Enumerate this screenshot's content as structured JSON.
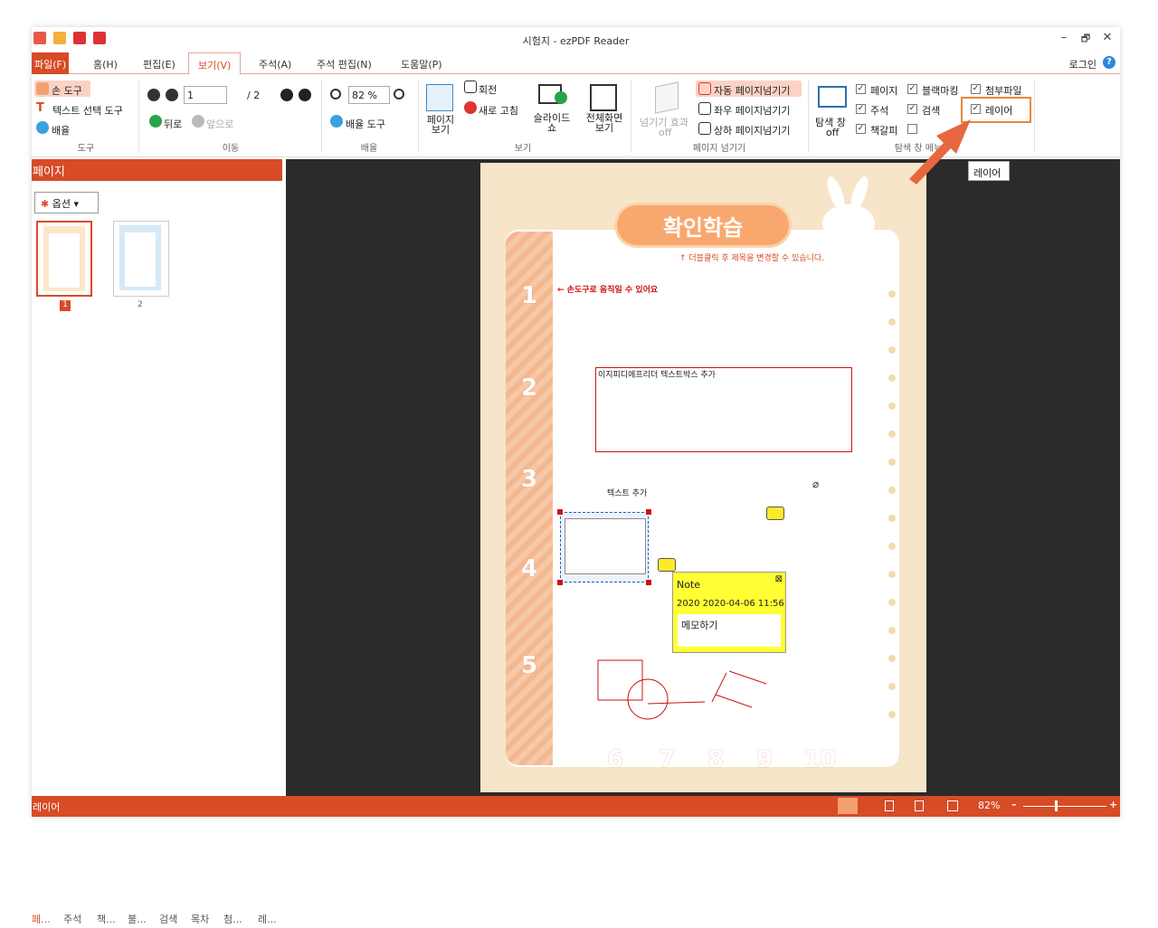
{
  "window": {
    "title": "시험지 - ezPDF Reader",
    "minimize": "–",
    "restore": "🗗",
    "close": "✕"
  },
  "menu": {
    "file": "파일(F)",
    "home": "홈(H)",
    "edit": "편집(E)",
    "view": "보기(V)",
    "annot": "주석(A)",
    "annot_edit": "주석 편집(N)",
    "help": "도움말(P)",
    "login": "로그인",
    "help_icon": "?"
  },
  "ribbon": {
    "tools": {
      "hand": "손 도구",
      "text_select": "텍스트 선택 도구",
      "zoom": "배율",
      "label": "도구"
    },
    "move": {
      "page_value": "1",
      "total": "/ 2",
      "back": "뒤로",
      "forward": "앞으로",
      "label": "이동"
    },
    "zoom": {
      "value": "82 %",
      "zoom_tool": "배율 도구",
      "label": "배율"
    },
    "view": {
      "page_view": "페이지 보기",
      "rotate": "회전",
      "refresh": "새로 고침",
      "slideshow": "슬라이드 쇼",
      "fullscreen": "전체화면 보기",
      "label": "보기"
    },
    "pageturn": {
      "effect": "넘기기 효과",
      "effect_state": "off",
      "auto": "자동 페이지넘기기",
      "lr": "좌우 페이지넘기기",
      "ud": "상하 페이지넘기기",
      "label": "페이지 넘기기"
    },
    "nav": {
      "nav_window": "탐색 창",
      "nav_state": "off",
      "cb_page": "페이지",
      "cb_blackmark": "블랙마킹",
      "cb_attach": "첨부파일",
      "cb_annot": "주석",
      "cb_search": "검색",
      "cb_layer": "레이어",
      "cb_bookmark": "책갈피",
      "label": "탐색 창 메뉴"
    },
    "tooltip": "레이어"
  },
  "sidebar": {
    "title": "페이지",
    "options": "옵션",
    "thumbs": [
      {
        "label": "1"
      },
      {
        "label": "2"
      }
    ],
    "tabs": [
      "페...",
      "주석",
      "책...",
      "불...",
      "검색",
      "목차",
      "첨...",
      "레..."
    ]
  },
  "document": {
    "header": "확인학습",
    "hint": "↑ 더블클릭 후 제목을 변경할 수 있습니다.",
    "hand_hint": "← 손도구로 움직일 수 있어요",
    "textbox": "이지피디에프리더 텍스트박스 추가",
    "text_add": "텍스트 추가",
    "numbers": [
      "1",
      "2",
      "3",
      "4",
      "5"
    ],
    "bottom_numbers": [
      "6",
      "7",
      "8",
      "9",
      "10"
    ],
    "note": {
      "title": "Note",
      "date": "2020 2020-04-06 11:56",
      "body": "메모하기"
    }
  },
  "status": {
    "left": "레이어",
    "zoom": "82%",
    "minus": "–",
    "plus": "+"
  },
  "colors": {
    "accent": "#d74b26",
    "page_bg": "#f6e5c8",
    "header_bg": "#f8a86e"
  }
}
